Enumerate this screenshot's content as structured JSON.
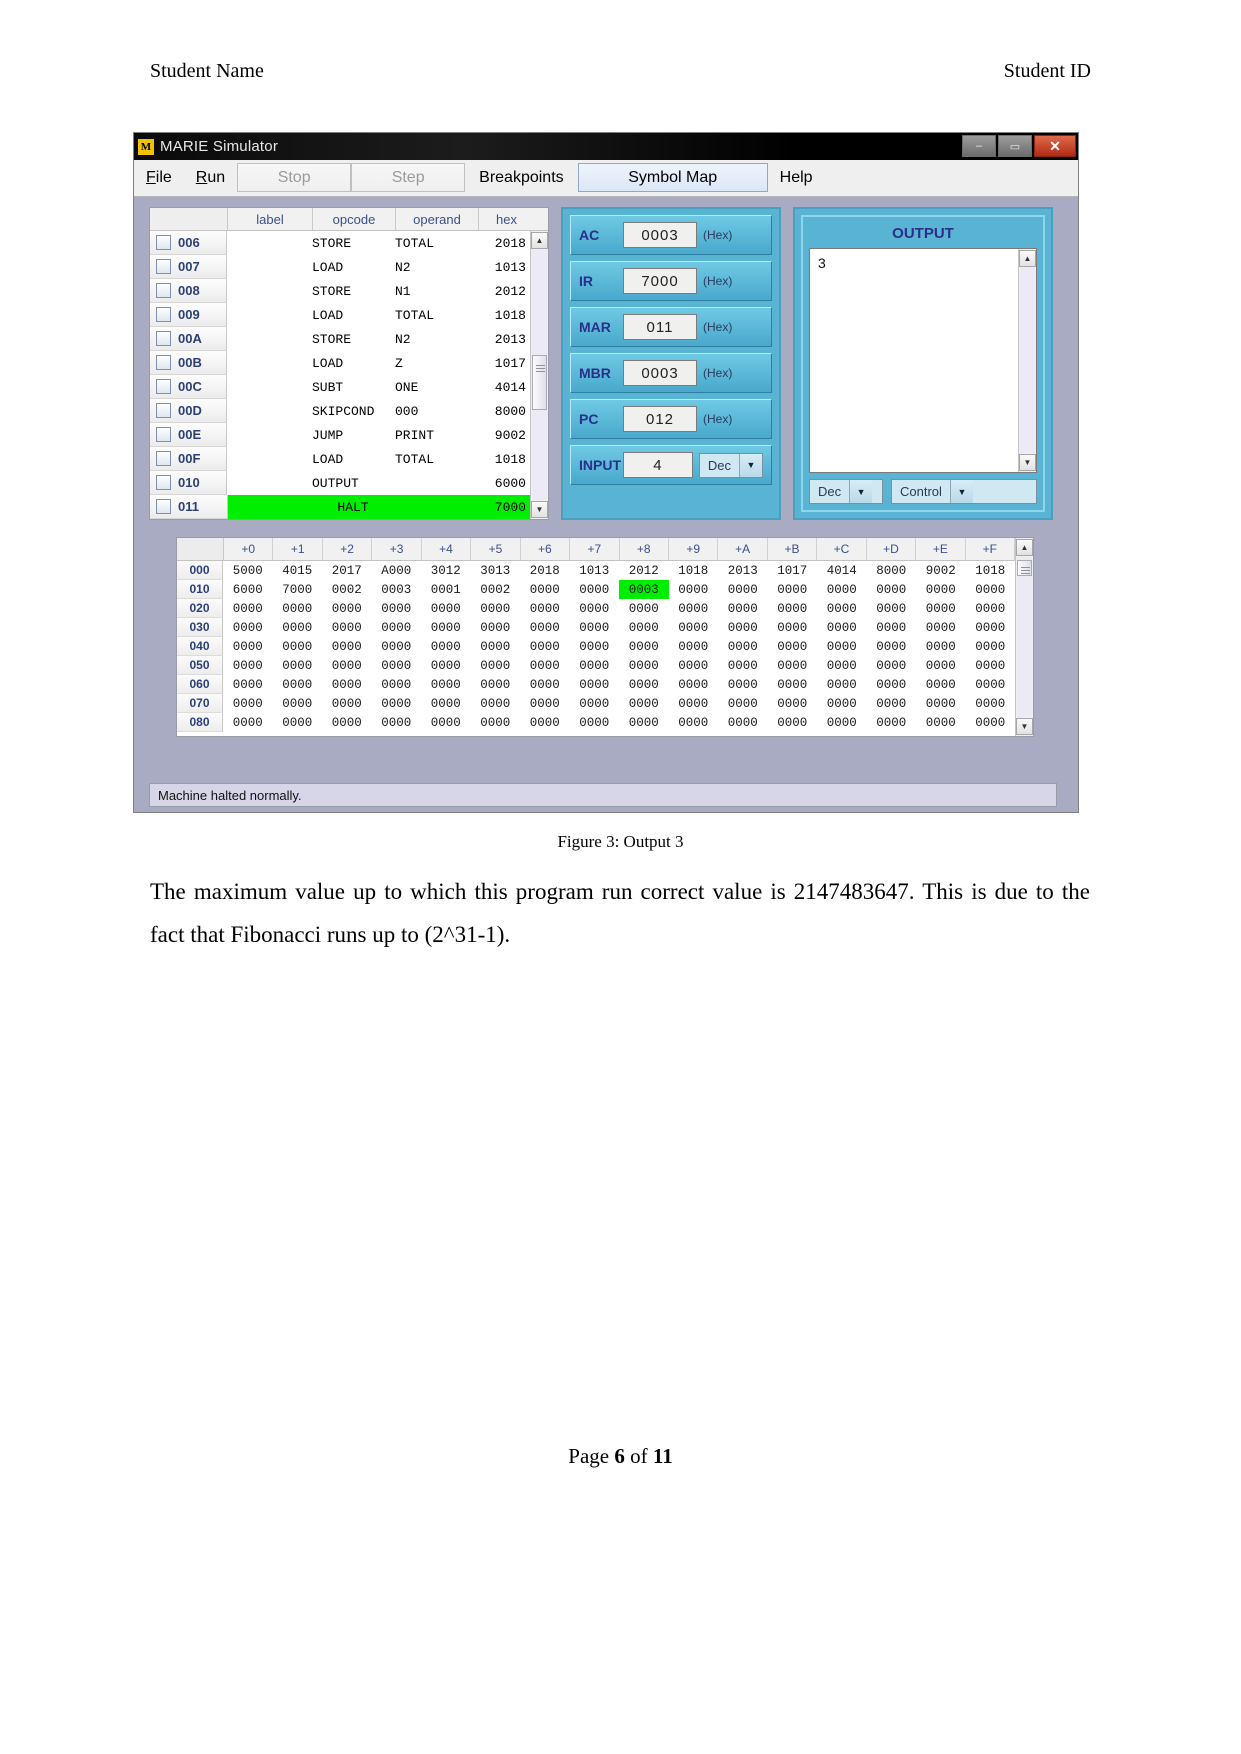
{
  "document": {
    "header_left": "Student Name",
    "header_right": "Student ID",
    "caption": "Figure 3: Output 3",
    "paragraph": "The maximum value up to which this program run correct value is 2147483647. This is due to the fact that Fibonacci runs up to (2^31-1).",
    "footer_prefix": "Page ",
    "footer_page": "6",
    "footer_mid": " of ",
    "footer_total": "11"
  },
  "simulator": {
    "title": "MARIE Simulator",
    "title_icon": "M",
    "window_buttons": {
      "minimize": "–",
      "maximize": "▭",
      "close": "✕"
    },
    "menu": [
      {
        "label": "File",
        "type": "menu",
        "enabled": true
      },
      {
        "label": "Run",
        "type": "menu",
        "enabled": true
      },
      {
        "label": "Stop",
        "type": "button",
        "enabled": false
      },
      {
        "label": "Step",
        "type": "button",
        "enabled": false
      },
      {
        "label": "Breakpoints",
        "type": "button",
        "enabled": true
      },
      {
        "label": "Symbol Map",
        "type": "button",
        "enabled": true,
        "active": true
      },
      {
        "label": "Help",
        "type": "menu",
        "enabled": true
      }
    ],
    "code_listing": {
      "columns": [
        "",
        "label",
        "opcode",
        "operand",
        "hex"
      ],
      "rows": [
        {
          "addr": "006",
          "label": "",
          "opcode": "STORE",
          "operand": "TOTAL",
          "hex": "2018",
          "highlight": false
        },
        {
          "addr": "007",
          "label": "",
          "opcode": "LOAD",
          "operand": "N2",
          "hex": "1013",
          "highlight": false
        },
        {
          "addr": "008",
          "label": "",
          "opcode": "STORE",
          "operand": "N1",
          "hex": "2012",
          "highlight": false
        },
        {
          "addr": "009",
          "label": "",
          "opcode": "LOAD",
          "operand": "TOTAL",
          "hex": "1018",
          "highlight": false
        },
        {
          "addr": "00A",
          "label": "",
          "opcode": "STORE",
          "operand": "N2",
          "hex": "2013",
          "highlight": false
        },
        {
          "addr": "00B",
          "label": "",
          "opcode": "LOAD",
          "operand": "Z",
          "hex": "1017",
          "highlight": false
        },
        {
          "addr": "00C",
          "label": "",
          "opcode": "SUBT",
          "operand": "ONE",
          "hex": "4014",
          "highlight": false
        },
        {
          "addr": "00D",
          "label": "",
          "opcode": "SKIPCOND",
          "operand": "000",
          "hex": "8000",
          "highlight": false
        },
        {
          "addr": "00E",
          "label": "",
          "opcode": "JUMP",
          "operand": "PRINT",
          "hex": "9002",
          "highlight": false
        },
        {
          "addr": "00F",
          "label": "",
          "opcode": "LOAD",
          "operand": "TOTAL",
          "hex": "1018",
          "highlight": false
        },
        {
          "addr": "010",
          "label": "",
          "opcode": "OUTPUT",
          "operand": "",
          "hex": "6000",
          "highlight": false
        },
        {
          "addr": "011",
          "label": "",
          "opcode": "HALT",
          "operand": "",
          "hex": "7000",
          "highlight": true
        }
      ]
    },
    "registers": [
      {
        "name": "AC",
        "value": "0003",
        "unit": "(Hex)"
      },
      {
        "name": "IR",
        "value": "7000",
        "unit": "(Hex)"
      },
      {
        "name": "MAR",
        "value": "011",
        "unit": "(Hex)"
      },
      {
        "name": "MBR",
        "value": "0003",
        "unit": "(Hex)"
      },
      {
        "name": "PC",
        "value": "012",
        "unit": "(Hex)"
      }
    ],
    "input": {
      "label": "INPUT",
      "value": "4",
      "mode": "Dec"
    },
    "output": {
      "title": "OUTPUT",
      "text": "3",
      "mode": "Dec",
      "control": "Control"
    },
    "memory": {
      "col_headers": [
        "+0",
        "+1",
        "+2",
        "+3",
        "+4",
        "+5",
        "+6",
        "+7",
        "+8",
        "+9",
        "+A",
        "+B",
        "+C",
        "+D",
        "+E",
        "+F"
      ],
      "rows": [
        {
          "addr": "000",
          "values": [
            "5000",
            "4015",
            "2017",
            "A000",
            "3012",
            "3013",
            "2018",
            "1013",
            "2012",
            "1018",
            "2013",
            "1017",
            "4014",
            "8000",
            "9002",
            "1018"
          ],
          "highlight_index": -1
        },
        {
          "addr": "010",
          "values": [
            "6000",
            "7000",
            "0002",
            "0003",
            "0001",
            "0002",
            "0000",
            "0000",
            "0003",
            "0000",
            "0000",
            "0000",
            "0000",
            "0000",
            "0000",
            "0000"
          ],
          "highlight_index": 8
        },
        {
          "addr": "020",
          "values": [
            "0000",
            "0000",
            "0000",
            "0000",
            "0000",
            "0000",
            "0000",
            "0000",
            "0000",
            "0000",
            "0000",
            "0000",
            "0000",
            "0000",
            "0000",
            "0000"
          ],
          "highlight_index": -1
        },
        {
          "addr": "030",
          "values": [
            "0000",
            "0000",
            "0000",
            "0000",
            "0000",
            "0000",
            "0000",
            "0000",
            "0000",
            "0000",
            "0000",
            "0000",
            "0000",
            "0000",
            "0000",
            "0000"
          ],
          "highlight_index": -1
        },
        {
          "addr": "040",
          "values": [
            "0000",
            "0000",
            "0000",
            "0000",
            "0000",
            "0000",
            "0000",
            "0000",
            "0000",
            "0000",
            "0000",
            "0000",
            "0000",
            "0000",
            "0000",
            "0000"
          ],
          "highlight_index": -1
        },
        {
          "addr": "050",
          "values": [
            "0000",
            "0000",
            "0000",
            "0000",
            "0000",
            "0000",
            "0000",
            "0000",
            "0000",
            "0000",
            "0000",
            "0000",
            "0000",
            "0000",
            "0000",
            "0000"
          ],
          "highlight_index": -1
        },
        {
          "addr": "060",
          "values": [
            "0000",
            "0000",
            "0000",
            "0000",
            "0000",
            "0000",
            "0000",
            "0000",
            "0000",
            "0000",
            "0000",
            "0000",
            "0000",
            "0000",
            "0000",
            "0000"
          ],
          "highlight_index": -1
        },
        {
          "addr": "070",
          "values": [
            "0000",
            "0000",
            "0000",
            "0000",
            "0000",
            "0000",
            "0000",
            "0000",
            "0000",
            "0000",
            "0000",
            "0000",
            "0000",
            "0000",
            "0000",
            "0000"
          ],
          "highlight_index": -1
        },
        {
          "addr": "080",
          "values": [
            "0000",
            "0000",
            "0000",
            "0000",
            "0000",
            "0000",
            "0000",
            "0000",
            "0000",
            "0000",
            "0000",
            "0000",
            "0000",
            "0000",
            "0000",
            "0000"
          ],
          "highlight_index": -1
        }
      ]
    },
    "status": "Machine halted normally.",
    "colors": {
      "highlight_green": "#00ef00",
      "panel_blue": "#59b4d4",
      "body_gray": "#a9abc2",
      "addr_text": "#2b3f7a"
    }
  }
}
